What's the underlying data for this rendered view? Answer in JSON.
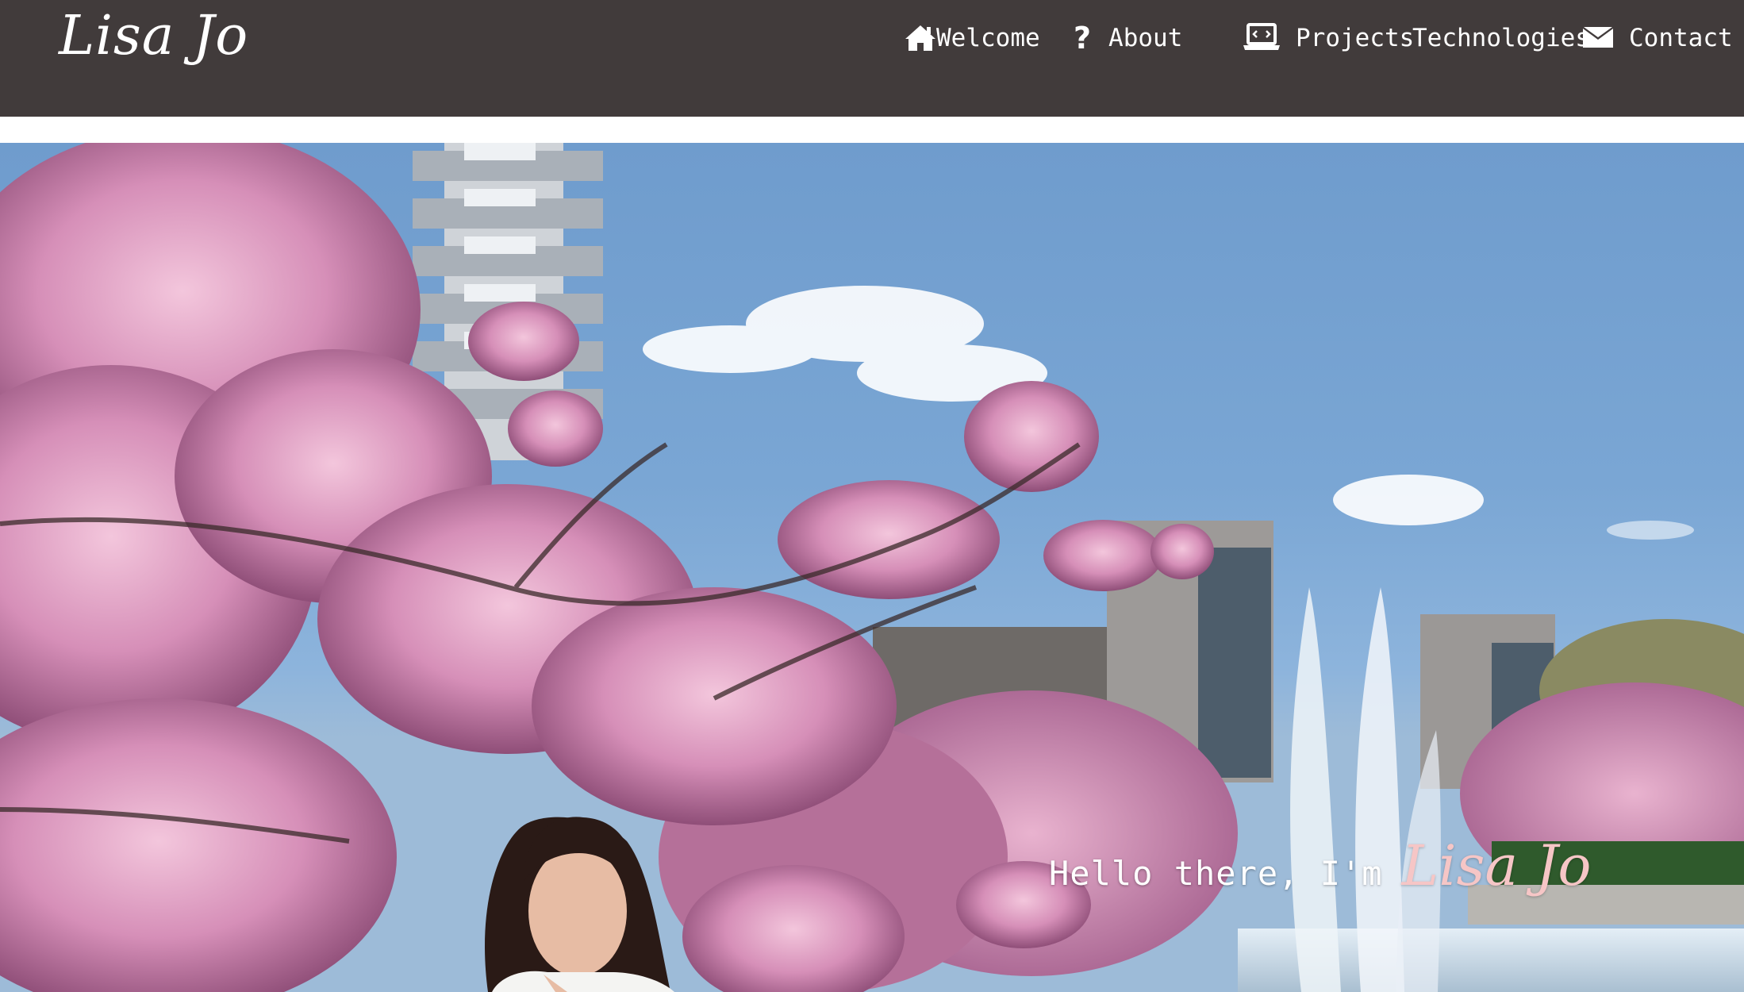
{
  "brand": {
    "name": "Lisa Jo"
  },
  "nav": {
    "items": [
      {
        "label": "Welcome",
        "icon": "home-icon"
      },
      {
        "label": "About",
        "icon": "question-icon"
      },
      {
        "label": "Projects",
        "icon": "laptop-code-icon"
      },
      {
        "label": "Technologies",
        "icon": ""
      },
      {
        "label": "Contact",
        "icon": "envelope-icon"
      }
    ]
  },
  "hero": {
    "greeting": "Hello there, I'm",
    "name": "Lisa Jo",
    "photo_subject": "portrait-among-cherry-blossoms"
  },
  "colors": {
    "navbar": "#413b3b",
    "nav_text": "#ffffff",
    "sky": "#7aa6d4",
    "blossom": "#d99bbf",
    "name_accent": "#f6c6c6"
  }
}
